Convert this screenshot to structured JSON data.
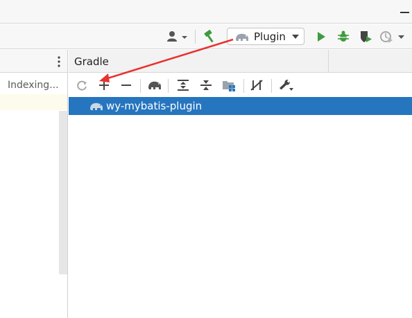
{
  "toolbar": {
    "run_config_label": "Plugin"
  },
  "left_panel": {
    "status_text": "Indexing..."
  },
  "gradle": {
    "title": "Gradle",
    "project_name": "wy-mybatis-plugin"
  },
  "colors": {
    "selection": "#2675bf",
    "run_green": "#3f9b3f",
    "annotation_arrow": "#e8322f"
  }
}
